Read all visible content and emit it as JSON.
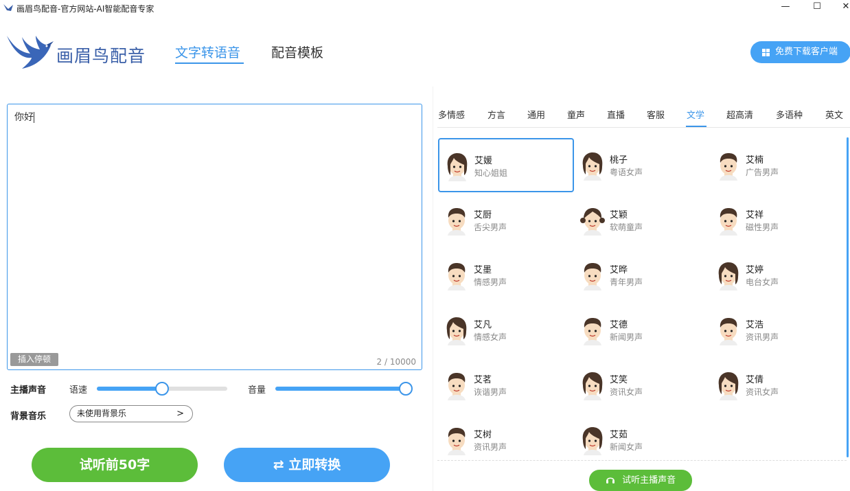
{
  "window": {
    "title": "画眉鸟配音-官方网站-AI智能配音专家",
    "minimize": "—",
    "maximize": "☐",
    "close": "✕"
  },
  "header": {
    "brand": "画眉鸟配音",
    "tabs": [
      {
        "label": "文字转语音",
        "active": true
      },
      {
        "label": "配音模板",
        "active": false
      }
    ],
    "download_button": "免费下载客户端"
  },
  "editor": {
    "text": "你好",
    "insert_pause": "插入停顿",
    "counter": "2 / 10000"
  },
  "controls": {
    "anchor_label": "主播声音",
    "speed_label": "语速",
    "speed_value": 0.49,
    "volume_label": "音量",
    "volume_value": 1.0,
    "bgm_label": "背景音乐",
    "bgm_value": "未使用背景乐",
    "bgm_chevron": ">",
    "preview_button": "试听前50字",
    "convert_button": "立即转换",
    "convert_icon": "⇄"
  },
  "categories": [
    {
      "label": "多情感",
      "active": false
    },
    {
      "label": "方言",
      "active": false
    },
    {
      "label": "通用",
      "active": false
    },
    {
      "label": "童声",
      "active": false
    },
    {
      "label": "直播",
      "active": false
    },
    {
      "label": "客服",
      "active": false
    },
    {
      "label": "文学",
      "active": true
    },
    {
      "label": "超高清",
      "active": false
    },
    {
      "label": "多语种",
      "active": false
    },
    {
      "label": "英文",
      "active": false
    }
  ],
  "voices": [
    {
      "name": "艾媛",
      "desc": "知心姐姐",
      "gender": "female",
      "selected": true
    },
    {
      "name": "桃子",
      "desc": "粤语女声",
      "gender": "female"
    },
    {
      "name": "艾楠",
      "desc": "广告男声",
      "gender": "male"
    },
    {
      "name": "艾厨",
      "desc": "舌尖男声",
      "gender": "male"
    },
    {
      "name": "艾颖",
      "desc": "软萌童声",
      "gender": "child"
    },
    {
      "name": "艾祥",
      "desc": "磁性男声",
      "gender": "male"
    },
    {
      "name": "艾墨",
      "desc": "情感男声",
      "gender": "male"
    },
    {
      "name": "艾晔",
      "desc": "青年男声",
      "gender": "male"
    },
    {
      "name": "艾婷",
      "desc": "电台女声",
      "gender": "female"
    },
    {
      "name": "艾凡",
      "desc": "情感女声",
      "gender": "female"
    },
    {
      "name": "艾德",
      "desc": "新闻男声",
      "gender": "male"
    },
    {
      "name": "艾浩",
      "desc": "资讯男声",
      "gender": "male"
    },
    {
      "name": "艾茗",
      "desc": "诙谐男声",
      "gender": "male"
    },
    {
      "name": "艾笑",
      "desc": "资讯女声",
      "gender": "female"
    },
    {
      "name": "艾倩",
      "desc": "资讯女声",
      "gender": "female"
    },
    {
      "name": "艾树",
      "desc": "资讯男声",
      "gender": "male"
    },
    {
      "name": "艾茹",
      "desc": "新闻女声",
      "gender": "female"
    }
  ],
  "preview_anchor_button": "试听主播声音",
  "colors": {
    "accent": "#3b95e9",
    "green": "#5cbd3a",
    "brand": "#3a5fa8"
  }
}
